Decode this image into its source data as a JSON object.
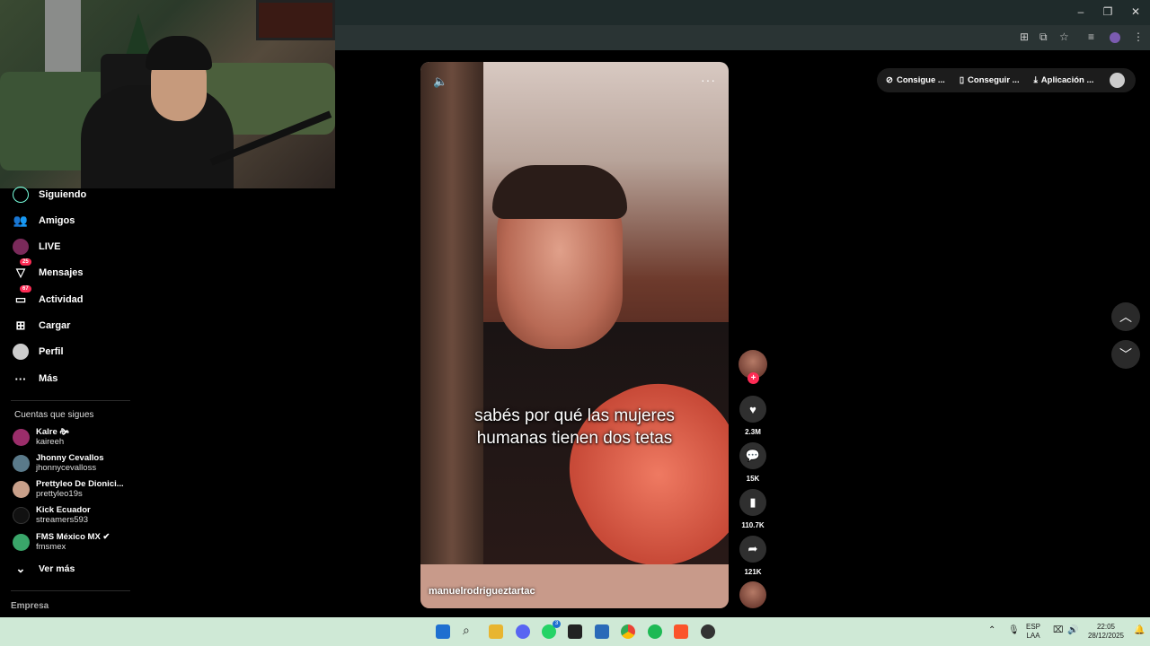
{
  "browser": {
    "icons": [
      "translate-icon",
      "cast-icon",
      "star-icon",
      "playlist-icon",
      "profile-icon",
      "menu-dots-icon"
    ]
  },
  "window": {
    "minimize": "–",
    "restore": "❐",
    "close": "✕"
  },
  "sidebar": {
    "items": [
      {
        "label": "Siguiendo",
        "icon": "following-icon"
      },
      {
        "label": "Amigos",
        "icon": "friends-icon"
      },
      {
        "label": "LIVE",
        "icon": "live-icon"
      },
      {
        "label": "Mensajes",
        "icon": "messages-icon",
        "badge": "25"
      },
      {
        "label": "Actividad",
        "icon": "activity-icon",
        "badge": "67"
      },
      {
        "label": "Cargar",
        "icon": "upload-icon"
      },
      {
        "label": "Perfil",
        "icon": "profile-icon"
      },
      {
        "label": "Más",
        "icon": "more-icon"
      }
    ],
    "following_title": "Cuentas que sigues",
    "following": [
      {
        "name": "Kalre 🙞",
        "user": "kaireeh",
        "color": "#9b2d6a"
      },
      {
        "name": "Jhonny Cevallos",
        "user": "jhonnycevalloss",
        "color": "#5a7a8a"
      },
      {
        "name": "Prettyleo De Dionici...",
        "user": "prettyleo19s",
        "color": "#c9a08a"
      },
      {
        "name": "Kick Ecuador",
        "user": "streamers593",
        "color": "#111111"
      },
      {
        "name": "FMS México MX ✔",
        "user": "fmsmex",
        "color": "#3aa66a"
      }
    ],
    "see_more": "Ver más",
    "company": "Empresa"
  },
  "video": {
    "caption_line1": "sabés por qué las mujeres",
    "caption_line2": "humanas tienen dos tetas",
    "username": "manuelrodrigueztartac",
    "mute_icon": "🔈",
    "more_icon": "···"
  },
  "actions": {
    "likes": "2.3M",
    "comments": "15K",
    "saves": "110.7K",
    "shares": "121K"
  },
  "top_buttons": {
    "coins": "Consigue ...",
    "app": "Conseguir ...",
    "download": "Aplicación ..."
  },
  "taskbar": {
    "lang1": "ESP",
    "lang2": "LAA",
    "time": "22:05",
    "date": "28/12/2025",
    "whatsapp_badge": "3"
  },
  "colors": {
    "accent": "#fe2c55",
    "taskbar": "#cfe9d6"
  }
}
